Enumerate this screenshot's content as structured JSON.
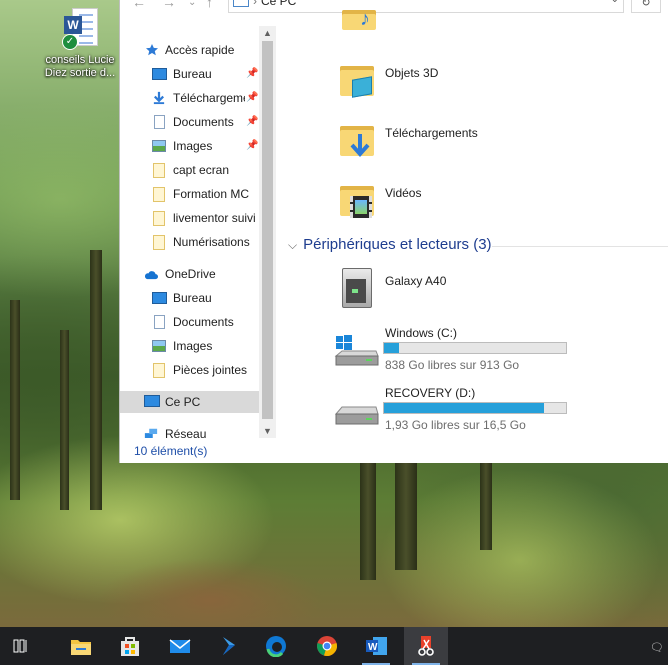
{
  "desktop": {
    "icon_label_line1": "conseils Lucie",
    "icon_label_line2": "Diez sortie d...",
    "icon_badge": "W"
  },
  "address_bar": {
    "location": "Ce PC"
  },
  "nav_pane": {
    "items": [
      {
        "label": "Accès rapide",
        "icon": "star-icon"
      },
      {
        "label": "Bureau",
        "icon": "desktop-icon",
        "pinned": true
      },
      {
        "label": "Téléchargements",
        "icon": "download-icon",
        "pinned": true
      },
      {
        "label": "Documents",
        "icon": "document-icon",
        "pinned": true
      },
      {
        "label": "Images",
        "icon": "pictures-icon",
        "pinned": true
      },
      {
        "label": "capt ecran",
        "icon": "folder-icon"
      },
      {
        "label": "Formation MC",
        "icon": "folder-icon"
      },
      {
        "label": "livementor suivi",
        "icon": "folder-icon"
      },
      {
        "label": "Numérisations",
        "icon": "folder-icon"
      },
      {
        "label": "OneDrive",
        "icon": "cloud-icon"
      },
      {
        "label": "Bureau",
        "icon": "desktop-icon"
      },
      {
        "label": "Documents",
        "icon": "document-icon"
      },
      {
        "label": "Images",
        "icon": "pictures-icon"
      },
      {
        "label": "Pièces jointes",
        "icon": "folder-icon"
      },
      {
        "label": "Ce PC",
        "icon": "computer-icon",
        "selected": true
      },
      {
        "label": "Réseau",
        "icon": "network-icon"
      }
    ],
    "pin_glyph": "📌"
  },
  "status_bar": {
    "count": "10 élément(s)"
  },
  "content": {
    "folders": [
      {
        "label": "Objets 3D",
        "icon": "3d-objects-folder-icon"
      },
      {
        "label": "Téléchargements",
        "icon": "downloads-folder-icon"
      },
      {
        "label": "Vidéos",
        "icon": "videos-folder-icon"
      }
    ],
    "section_title": "Périphériques et lecteurs (3)",
    "devices": [
      {
        "label": "Galaxy A40",
        "icon": "phone-device-icon"
      },
      {
        "label": "Windows (C:)",
        "icon": "windows-drive-icon",
        "free": "838 Go libres sur 913 Go",
        "used_fraction": 0.08
      },
      {
        "label": "RECOVERY (D:)",
        "icon": "drive-icon",
        "free": "1,93 Go libres sur 16,5 Go",
        "used_fraction": 0.88
      }
    ]
  },
  "taskbar": {
    "apps": [
      {
        "name": "task-view"
      },
      {
        "name": "file-explorer"
      },
      {
        "name": "microsoft-store"
      },
      {
        "name": "mail"
      },
      {
        "name": "visual-studio"
      },
      {
        "name": "edge"
      },
      {
        "name": "chrome"
      },
      {
        "name": "word",
        "badge": "W"
      },
      {
        "name": "snipping-tool",
        "active": true
      }
    ]
  },
  "colors": {
    "accent": "#26a0da",
    "section_blue": "#1e3d8f",
    "taskbar": "#1e1f22"
  }
}
